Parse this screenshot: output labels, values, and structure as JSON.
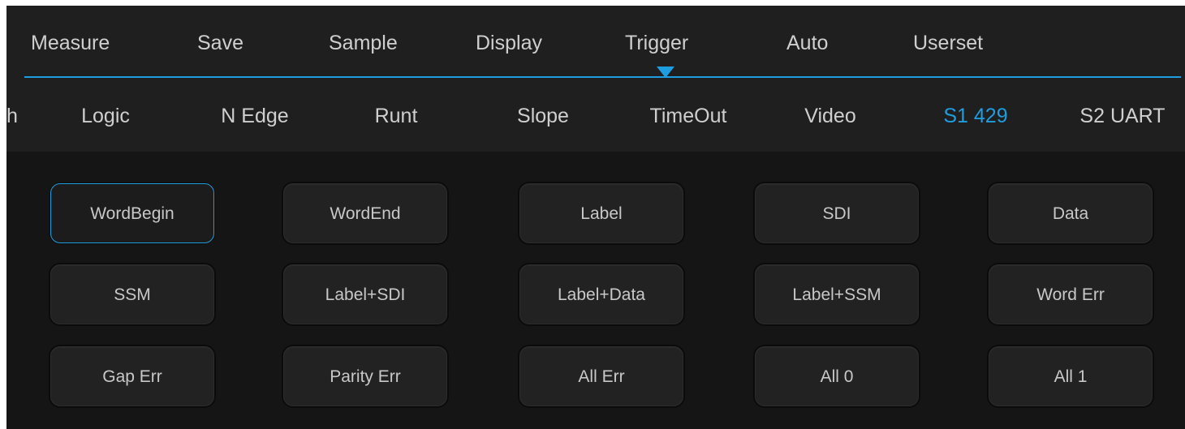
{
  "top_menu": {
    "items": [
      "Measure",
      "Save",
      "Sample",
      "Display",
      "Trigger",
      "Auto",
      "Userset"
    ],
    "active": "Trigger"
  },
  "trigger_types": {
    "items": [
      "h",
      "Logic",
      "N Edge",
      "Runt",
      "Slope",
      "TimeOut",
      "Video",
      "S1 429",
      "S2 UART"
    ],
    "active": "S1 429"
  },
  "condition_buttons": {
    "items": [
      "WordBegin",
      "WordEnd",
      "Label",
      "SDI",
      "Data",
      "SSM",
      "Label+SDI",
      "Label+Data",
      "Label+SSM",
      "Word Err",
      "Gap Err",
      "Parity Err",
      "All Err",
      "All 0",
      "All 1"
    ],
    "selected": "WordBegin"
  },
  "colors": {
    "accent": "#1e9ee0",
    "panel": "#1f1f1f",
    "background": "#151515",
    "text": "#cfcfcf"
  }
}
